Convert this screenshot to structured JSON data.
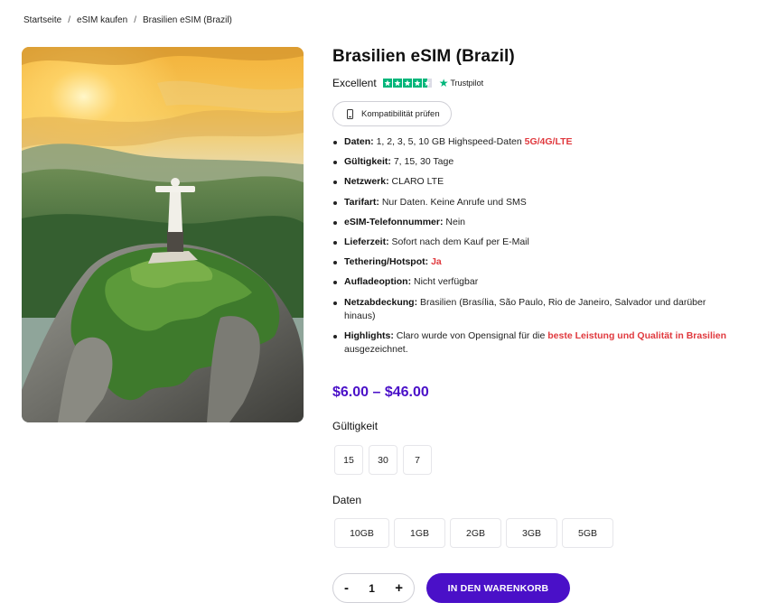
{
  "breadcrumb": {
    "items": [
      "Startseite",
      "eSIM kaufen",
      "Brasilien eSIM (Brazil)"
    ]
  },
  "product": {
    "title": "Brasilien eSIM (Brazil)",
    "rating_label": "Excellent",
    "trustpilot_label": "Trustpilot",
    "compatibility_label": "Kompatibilität prüfen",
    "price": "$6.00 – $46.00",
    "image_alt": "Christ the Redeemer statue on Corcovado at sunrise",
    "features": [
      {
        "label": "Daten:",
        "text": " 1, 2, 3, 5, 10 GB Highspeed-Daten ",
        "highlight": "5G/4G/LTE",
        "after": ""
      },
      {
        "label": "Gültigkeit:",
        "text": " 7, 15, 30 Tage",
        "highlight": "",
        "after": ""
      },
      {
        "label": "Netzwerk:",
        "text": " CLARO LTE",
        "highlight": "",
        "after": ""
      },
      {
        "label": "Tarifart:",
        "text": " Nur Daten. Keine Anrufe und SMS",
        "highlight": "",
        "after": ""
      },
      {
        "label": "eSIM-Telefonnummer:",
        "text": " Nein",
        "highlight": "",
        "after": ""
      },
      {
        "label": "Lieferzeit:",
        "text": " Sofort nach dem Kauf per E-Mail",
        "highlight": "",
        "after": ""
      },
      {
        "label": "Tethering/Hotspot:",
        "text": " ",
        "highlight": "Ja",
        "after": ""
      },
      {
        "label": "Aufladeoption:",
        "text": " Nicht verfügbar",
        "highlight": "",
        "after": ""
      },
      {
        "label": "Netzabdeckung:",
        "text": " Brasilien (Brasília, São Paulo, Rio de Janeiro, Salvador und darüber hinaus)",
        "highlight": "",
        "after": ""
      },
      {
        "label": "Highlights:",
        "text": " Claro wurde von Opensignal für die ",
        "highlight": "beste Leistung und Qualität in Brasilien",
        "after": " ausgezeichnet."
      }
    ]
  },
  "validity": {
    "label": "Gültigkeit",
    "options": [
      "15",
      "30",
      "7"
    ]
  },
  "data_options": {
    "label": "Daten",
    "options": [
      "10GB",
      "1GB",
      "2GB",
      "3GB",
      "5GB"
    ]
  },
  "cart": {
    "minus": "-",
    "quantity": "1",
    "plus": "+",
    "add_to_cart_label": "IN DEN WARENKORB"
  },
  "colors": {
    "accent": "#4a10c8",
    "highlight_red": "#e0393e",
    "trustpilot_green": "#00b67a"
  },
  "icons": {
    "compatibility": "phone-icon",
    "trustpilot": "star-icon"
  }
}
